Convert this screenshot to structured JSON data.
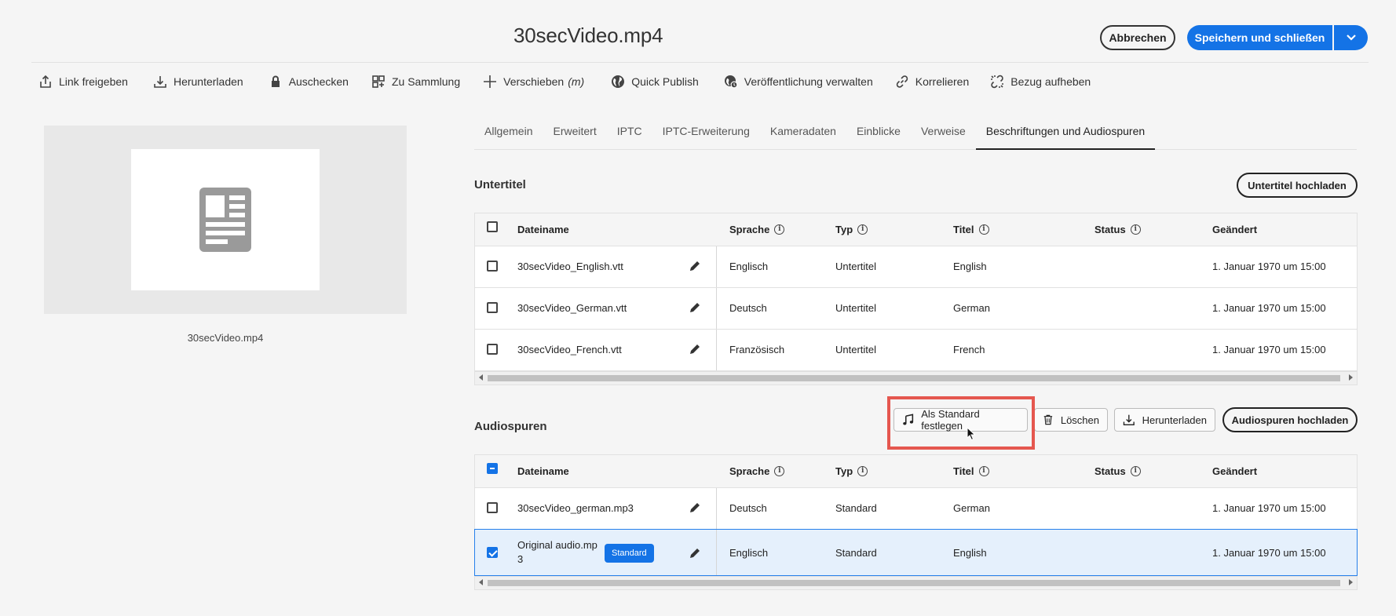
{
  "header": {
    "title": "30secVideo.mp4",
    "cancel_label": "Abbrechen",
    "save_label": "Speichern und schließen"
  },
  "toolbar": {
    "items": [
      {
        "label": "Link freigeben",
        "icon": "share-icon"
      },
      {
        "label": "Herunterladen",
        "icon": "download-icon"
      },
      {
        "label": "Auschecken",
        "icon": "lock-icon"
      },
      {
        "label": "Zu Sammlung",
        "icon": "add-to-collection-icon"
      },
      {
        "label": "Verschieben",
        "shortcut": "(m)",
        "icon": "move-icon"
      },
      {
        "label": "Quick Publish",
        "icon": "globe-icon"
      },
      {
        "label": "Veröffentlichung verwalten",
        "icon": "manage-publication-icon"
      },
      {
        "label": "Korrelieren",
        "icon": "link-icon"
      },
      {
        "label": "Bezug aufheben",
        "icon": "unlink-icon"
      }
    ]
  },
  "preview": {
    "filename": "30secVideo.mp4"
  },
  "tabs": [
    {
      "label": "Allgemein"
    },
    {
      "label": "Erweitert"
    },
    {
      "label": "IPTC"
    },
    {
      "label": "IPTC-Erweiterung"
    },
    {
      "label": "Kameradaten"
    },
    {
      "label": "Einblicke"
    },
    {
      "label": "Verweise"
    },
    {
      "label": "Beschriftungen und Audiospuren",
      "active": true
    }
  ],
  "subtitles": {
    "title": "Untertitel",
    "upload_label": "Untertitel hochladen",
    "columns": [
      "Dateiname",
      "Sprache",
      "Typ",
      "Titel",
      "Status",
      "Geändert"
    ],
    "rows": [
      {
        "filename": "30secVideo_English.vtt",
        "language": "Englisch",
        "type": "Untertitel",
        "title": "English",
        "status": "",
        "modified": "1. Januar 1970 um 15:00"
      },
      {
        "filename": "30secVideo_German.vtt",
        "language": "Deutsch",
        "type": "Untertitel",
        "title": "German",
        "status": "",
        "modified": "1. Januar 1970 um 15:00"
      },
      {
        "filename": "30secVideo_French.vtt",
        "language": "Französisch",
        "type": "Untertitel",
        "title": "French",
        "status": "",
        "modified": "1. Januar 1970 um 15:00"
      }
    ]
  },
  "audio": {
    "title": "Audiospuren",
    "set_default_label": "Als Standard festlegen",
    "delete_label": "Löschen",
    "download_label": "Herunterladen",
    "upload_label": "Audiospuren hochladen",
    "columns": [
      "Dateiname",
      "Sprache",
      "Typ",
      "Titel",
      "Status",
      "Geändert"
    ],
    "rows": [
      {
        "filename_line1": "30secVideo_german.mp3",
        "filename_line2": "",
        "badge": "",
        "language": "Deutsch",
        "type": "Standard",
        "title": "German",
        "status": "",
        "modified": "1. Januar 1970 um 15:00",
        "selected": false
      },
      {
        "filename_line1": "Original audio.mp",
        "filename_line2": "3",
        "badge": "Standard",
        "language": "Englisch",
        "type": "Standard",
        "title": "English",
        "status": "",
        "modified": "1. Januar 1970 um 15:00",
        "selected": true
      }
    ]
  },
  "colors": {
    "accent": "#1473e6",
    "highlight": "#e5574f",
    "selected_row": "#e5f0fc"
  }
}
